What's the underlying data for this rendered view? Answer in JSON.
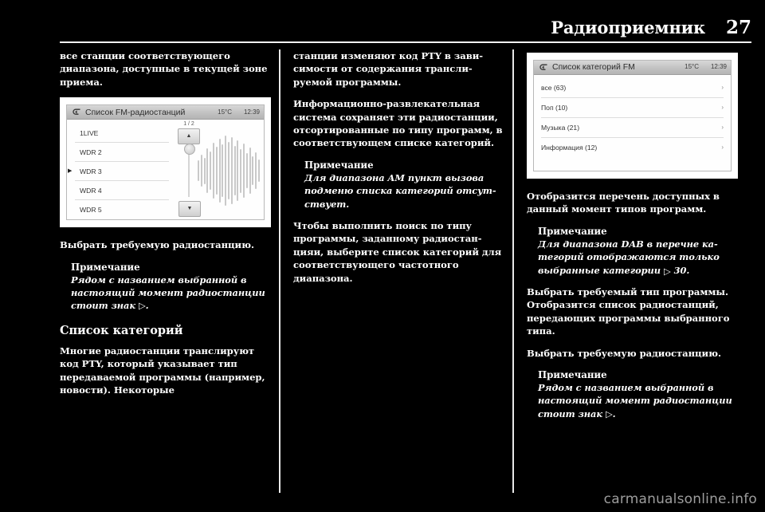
{
  "header": {
    "title": "Радиоприемник",
    "page_number": "27"
  },
  "column1": {
    "para1": "все станции соответствующего диапазона, доступные в текущей зоне приема.",
    "station_list_screen": {
      "back_icon": "back-arrow-icon",
      "title": "Список FM-радиостанций",
      "temperature": "15°C",
      "clock": "12:39",
      "page_indicator": "1 / 2",
      "up_arrow": "▲",
      "down_arrow": "▼",
      "stations": [
        {
          "name": "1LIVE",
          "playing": false
        },
        {
          "name": "WDR 2",
          "playing": false
        },
        {
          "name": "WDR 3",
          "playing": true
        },
        {
          "name": "WDR 4",
          "playing": false
        },
        {
          "name": "WDR 5",
          "playing": false
        }
      ]
    },
    "para2": "Выбрать требуемую радиостан­цию.",
    "note1_title": "Примечание",
    "note1_body": "Рядом с названием выбранной в настоящий момент радиостанции стоит знак ▷.",
    "section_heading": "Список категорий",
    "para3": "Многие радиостанции транслиру­ют код PTY, который указывает тип передаваемой программы (например, новости). Некоторые"
  },
  "column2": {
    "para1": "станции изменяют код PTY в зави­симости от содержания трансли­руемой программы.",
    "para2": "Информационно-развлекательная система сохраняет эти радиостан­ции, отсортированные по типу про­грамм, в соответствующем списке категорий.",
    "note1_title": "Примечание",
    "note1_body": "Для диапазона AM пункт вызова подменю списка категорий отсут­ствует.",
    "para3": "Чтобы выполнить поиск по типу программы, заданному радиостан­цияи, выберите список категорий для соответствующего частотного диапазона."
  },
  "column3": {
    "category_list_screen": {
      "back_icon": "back-arrow-icon",
      "title": "Список категорий FM",
      "temperature": "15°C",
      "clock": "12:39",
      "categories": [
        {
          "label": "все (63)",
          "chevron": "›"
        },
        {
          "label": "Поп (10)",
          "chevron": "›"
        },
        {
          "label": "Музыка (21)",
          "chevron": "›"
        },
        {
          "label": "Информация (12)",
          "chevron": "›"
        }
      ]
    },
    "para1": "Отобразится перечень доступных в данный момент типов программ.",
    "note1_title": "Примечание",
    "note1_body_a": "Для диапазона DAB в перечне ка­тегорий отображаются только вы­бранные категории ",
    "note1_ref_icon": "▷",
    "note1_ref_page": " 30.",
    "para2": "Выбрать требуемый тип про­граммы. Отобразится список ра­диостанций, передающих про­граммы выбранного типа.",
    "para3": "Выбрать требуемую радиостан­цию.",
    "note2_title": "Примечание",
    "note2_body": "Рядом с названием выбранной в настоящий момент радиостанции стоит знак ▷."
  },
  "footer": {
    "watermark": "carmanualsonline.info"
  },
  "colors": {
    "page_background": "#000000",
    "text": "#ffffff",
    "rule": "#f0f0f0",
    "watermark": "#9d9d9d"
  }
}
